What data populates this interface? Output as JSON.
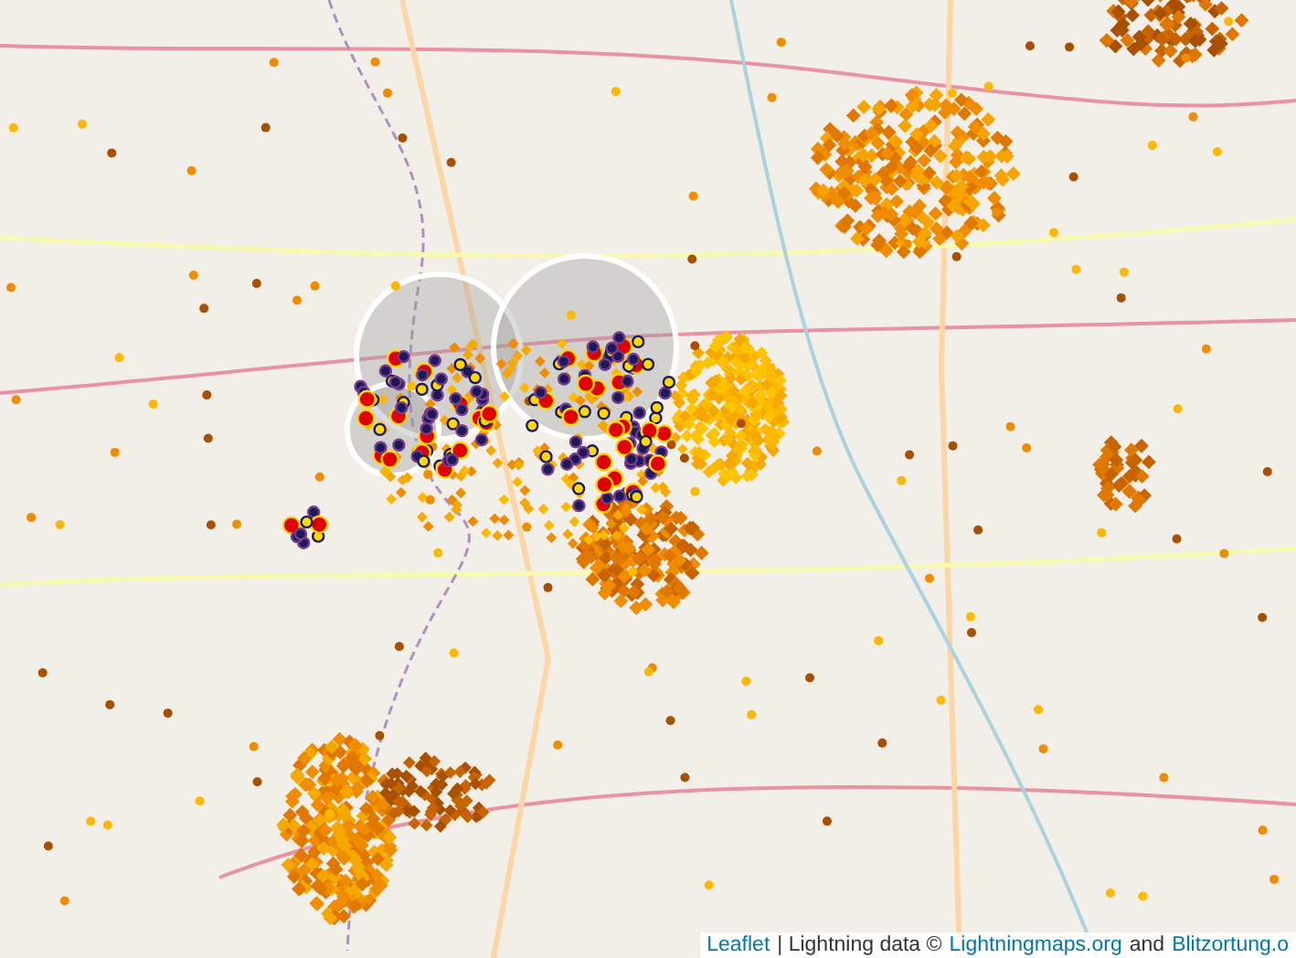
{
  "map": {
    "attribution": [
      {
        "kind": "link",
        "text": "Leaflet"
      },
      {
        "kind": "text",
        "text": "| Lightning data ©"
      },
      {
        "kind": "link",
        "text": "Lightningmaps.org"
      },
      {
        "kind": "text",
        "text": "and"
      },
      {
        "kind": "link",
        "text": "Blitzortung.o"
      }
    ]
  }
}
